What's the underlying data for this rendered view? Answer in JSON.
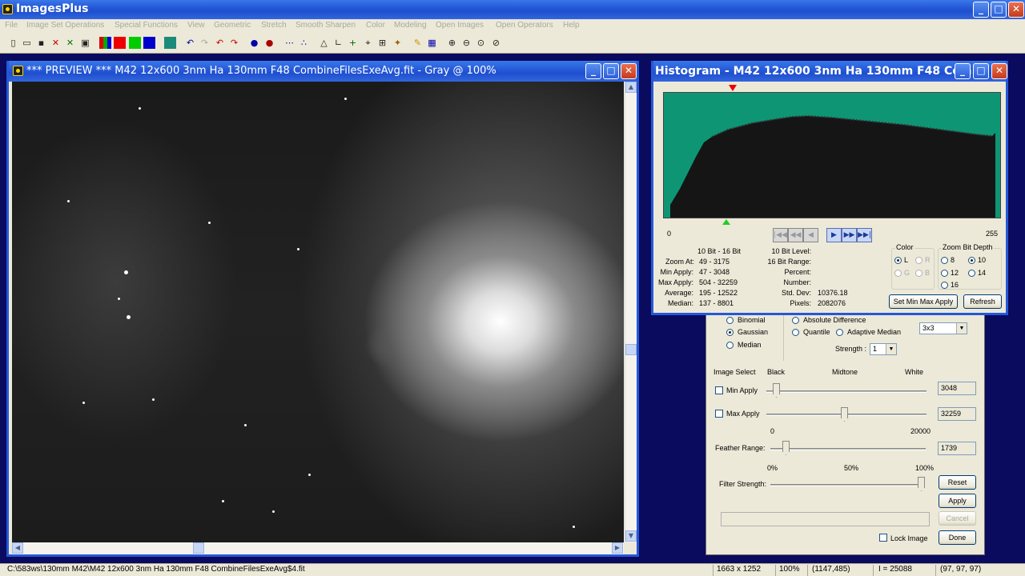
{
  "app": {
    "title": "ImagesPlus"
  },
  "menu": [
    "File",
    "Image Set Operations",
    "Special Functions",
    "View",
    "Geometric",
    "Stretch",
    "Smooth Sharpen",
    "Color",
    "Modeling",
    "Open Images",
    "Open Operators",
    "Help"
  ],
  "toolbar_icons": [
    "new-icon",
    "open-icon",
    "save-icon",
    "close-image-icon",
    "close-all-icon",
    "print-icon",
    "rgb-icon",
    "red-channel-icon",
    "green-channel-icon",
    "blue-channel-icon",
    "grid-icon",
    "undo-icon",
    "redo-icon",
    "undo-all-icon",
    "redo-all-icon",
    "blob-icon",
    "dot-icon",
    "dots-icon",
    "tilde-icon",
    "triangle-icon",
    "axis-icon",
    "plus-icon",
    "crosshair-icon",
    "box-icon",
    "stars-icon",
    "pencil-icon",
    "matrix-icon",
    "zoom-in-icon",
    "zoom-out-icon",
    "zoom-fit-icon",
    "zoom-100-icon"
  ],
  "preview": {
    "title": "*** PREVIEW *** M42 12x600 3nm Ha 130mm F48 CombineFilesExeAvg.fit - Gray @ 100%"
  },
  "histogram": {
    "title": "Histogram - M42 12x600 3nm Ha 130mm F48 Com...",
    "axis_min": "0",
    "axis_max": "255",
    "header": "10 Bit - 16 Bit",
    "rows": [
      {
        "label": "Zoom At:",
        "value": "49 - 3175"
      },
      {
        "label": "Min Apply:",
        "value": "47 - 3048"
      },
      {
        "label": "Max Apply:",
        "value": "504 - 32259"
      },
      {
        "label": "Average:",
        "value": "195 - 12522"
      },
      {
        "label": "Median:",
        "value": "137 - 8801"
      }
    ],
    "right_rows": [
      {
        "label": "10 Bit Level:",
        "value": ""
      },
      {
        "label": "16 Bit Range:",
        "value": ""
      },
      {
        "label": "Percent:",
        "value": ""
      },
      {
        "label": "Number:",
        "value": ""
      },
      {
        "label": "Std. Dev:",
        "value": "10376.18"
      },
      {
        "label": "Pixels:",
        "value": "2082076"
      }
    ],
    "color_group": "Color",
    "color_options": [
      "L",
      "R",
      "G",
      "B"
    ],
    "zoom_group": "Zoom Bit Depth",
    "zoom_options": [
      "8",
      "10",
      "12",
      "14",
      "16"
    ],
    "zoom_selected": "10",
    "set_minmax_label": "Set Min Max Apply",
    "refresh_label": "Refresh"
  },
  "filter": {
    "type_options": [
      "Binomial",
      "Gaussian",
      "Median"
    ],
    "type_selected": "Gaussian",
    "method_options": [
      "Absolute Difference",
      "Quantile",
      "Adaptive Median"
    ],
    "strength_label": "Strength :",
    "strength_value": "1",
    "kernel_value": "3x3",
    "image_select_label": "Image Select",
    "black_label": "Black",
    "midtone_label": "Midtone",
    "white_label": "White",
    "min_apply_label": "Min Apply",
    "min_apply_value": "3048",
    "max_apply_label": "Max Apply",
    "max_apply_value": "32259",
    "feather_min": "0",
    "feather_max": "20000",
    "feather_label": "Feather Range:",
    "feather_value": "1739",
    "pct0": "0%",
    "pct50": "50%",
    "pct100": "100%",
    "filter_strength_label": "Filter Strength:",
    "reset_label": "Reset",
    "apply_label": "Apply",
    "cancel_label": "Cancel",
    "lock_label": "Lock Image",
    "done_label": "Done"
  },
  "status": {
    "path": "C:\\583ws\\130mm M42\\M42 12x600 3nm Ha 130mm F48 CombineFilesExeAvg$4.fit",
    "size": "1663 x 1252",
    "zoom": "100%",
    "coords": "(1147,485)",
    "intensity": "I = 25088",
    "rgb": "(97, 97, 97)"
  },
  "colors": {
    "titlebar": "#2458d8",
    "desktop": "#0a0a5e",
    "histogram_bg": "#0e9674"
  }
}
